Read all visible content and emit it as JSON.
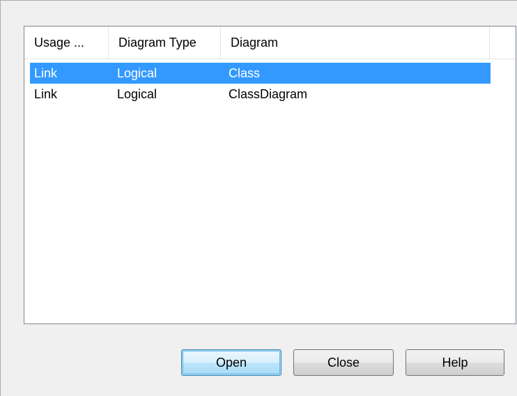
{
  "list": {
    "columns": [
      "Usage ...",
      "Diagram Type",
      "Diagram",
      ""
    ],
    "rows": [
      {
        "usage": "Link",
        "diagram_type": "Logical",
        "diagram": "Class",
        "selected": true
      },
      {
        "usage": "Link",
        "diagram_type": "Logical",
        "diagram": "ClassDiagram",
        "selected": false
      }
    ],
    "selection_color": "#3399ff"
  },
  "buttons": {
    "open": "Open",
    "close": "Close",
    "help": "Help"
  }
}
